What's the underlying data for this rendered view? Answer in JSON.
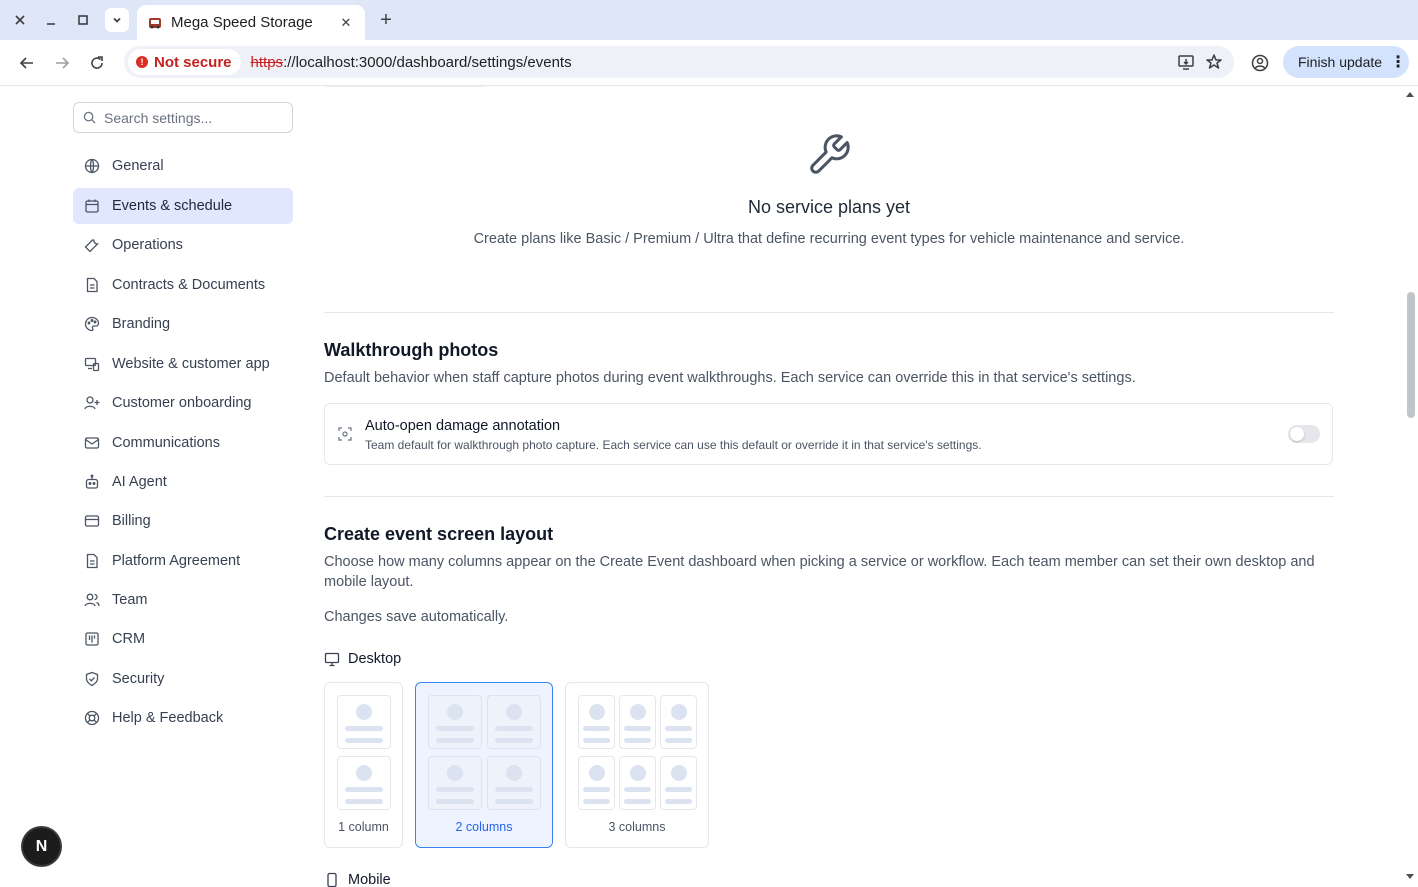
{
  "browser": {
    "tab_title": "Mega Speed Storage",
    "security_label": "Not secure",
    "url_scheme": "https",
    "url_rest": "://localhost:3000/dashboard/settings/events",
    "update_button": "Finish update"
  },
  "sidebar": {
    "search_placeholder": "Search settings...",
    "items": [
      {
        "label": "General",
        "icon": "globe-icon",
        "active": false
      },
      {
        "label": "Events & schedule",
        "icon": "calendar-icon",
        "active": true
      },
      {
        "label": "Operations",
        "icon": "wrench-icon",
        "active": false
      },
      {
        "label": "Contracts & Documents",
        "icon": "document-icon",
        "active": false
      },
      {
        "label": "Branding",
        "icon": "palette-icon",
        "active": false
      },
      {
        "label": "Website & customer app",
        "icon": "devices-icon",
        "active": false
      },
      {
        "label": "Customer onboarding",
        "icon": "user-plus-icon",
        "active": false
      },
      {
        "label": "Communications",
        "icon": "mail-icon",
        "active": false
      },
      {
        "label": "AI Agent",
        "icon": "bot-icon",
        "active": false
      },
      {
        "label": "Billing",
        "icon": "credit-card-icon",
        "active": false
      },
      {
        "label": "Platform Agreement",
        "icon": "document-icon",
        "active": false
      },
      {
        "label": "Team",
        "icon": "users-icon",
        "active": false
      },
      {
        "label": "CRM",
        "icon": "kanban-icon",
        "active": false
      },
      {
        "label": "Security",
        "icon": "shield-icon",
        "active": false
      },
      {
        "label": "Help & Feedback",
        "icon": "lifebuoy-icon",
        "active": false
      }
    ]
  },
  "empty_state": {
    "title": "No service plans yet",
    "description": "Create plans like Basic / Premium / Ultra that define recurring event types for vehicle maintenance and service."
  },
  "walkthrough": {
    "title": "Walkthrough photos",
    "description": "Default behavior when staff capture photos during event walkthroughs. Each service can override this in that service's settings.",
    "setting_title": "Auto-open damage annotation",
    "setting_desc": "Team default for walkthrough photo capture. Each service can use this default or override it in that service's settings.",
    "enabled": false
  },
  "layout": {
    "title": "Create event screen layout",
    "description": "Choose how many columns appear on the Create Event dashboard when picking a service or workflow. Each team member can set their own desktop and mobile layout.",
    "autosave": "Changes save automatically.",
    "desktop_label": "Desktop",
    "mobile_label": "Mobile",
    "options": [
      "1 column",
      "2 columns",
      "3 columns"
    ],
    "selected": "2 columns"
  },
  "dev_badge": "N",
  "colors": {
    "accent": "#3b82f6",
    "active_nav": "#e0e7ff",
    "danger": "#c5221f"
  }
}
